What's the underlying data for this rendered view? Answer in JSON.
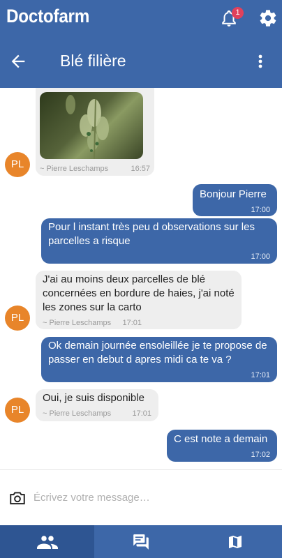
{
  "app": {
    "title": "Doctofarm",
    "notification_count": "1"
  },
  "conversation": {
    "title": "Blé filière"
  },
  "messages": [
    {
      "type": "image",
      "direction": "in",
      "author": "~ Pierre Leschamps",
      "time": "16:57",
      "avatar": "PL",
      "image_icon": "wheat-photo"
    },
    {
      "type": "text",
      "direction": "out",
      "text": "Bonjour Pierre",
      "time": "17:00"
    },
    {
      "type": "text",
      "direction": "out",
      "text": "Pour l instant très peu d observations sur les parcelles a risque",
      "time": "17:00"
    },
    {
      "type": "text",
      "direction": "in",
      "text": "J'ai au moins deux parcelles de blé concernées en bordure de haies, j'ai noté les zones sur la carto",
      "author": "~ Pierre Leschamps",
      "time": "17:01",
      "avatar": "PL"
    },
    {
      "type": "text",
      "direction": "out",
      "text": "Ok demain journée ensoleillée je te propose de passer en debut d apres midi ca te va ?",
      "time": "17:01"
    },
    {
      "type": "text",
      "direction": "in",
      "text": "Oui, je suis disponible",
      "author": "~ Pierre Leschamps",
      "time": "17:01",
      "avatar": "PL"
    },
    {
      "type": "text",
      "direction": "out",
      "text": "C est note a demain",
      "time": "17:02"
    }
  ],
  "composer": {
    "placeholder": "Écrivez votre message…",
    "value": ""
  },
  "tabs": [
    {
      "name": "contacts",
      "icon": "people-icon",
      "active": true
    },
    {
      "name": "messages",
      "icon": "chat-icon",
      "active": false
    },
    {
      "name": "map",
      "icon": "map-icon",
      "active": false
    }
  ],
  "colors": {
    "primary": "#3d67a8",
    "active_tab": "#2e5592",
    "avatar": "#e8852a",
    "badge": "#e0415c",
    "incoming_bubble": "#eeeeee"
  }
}
